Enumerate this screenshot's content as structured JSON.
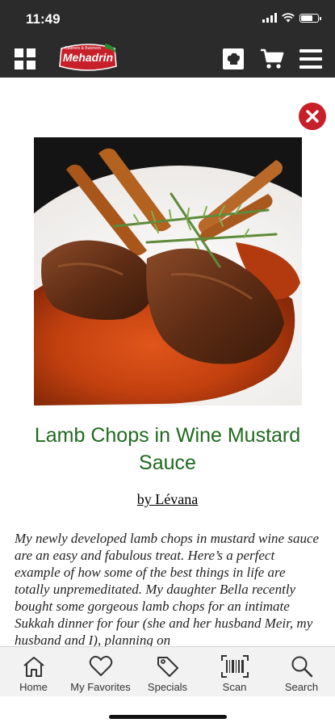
{
  "status_bar": {
    "time": "11:49",
    "icons": [
      "signal-icon",
      "wifi-icon",
      "battery-icon"
    ],
    "battery_level": 0.75
  },
  "header": {
    "menu_grid_icon": "grid-icon",
    "logo": {
      "text": "Mehadrin",
      "tagline": "Caterers & Butchers",
      "color": "#c8202a"
    },
    "icons": [
      "chef-hat-icon",
      "cart-icon",
      "hamburger-menu-icon"
    ],
    "background": "#2b2b2b"
  },
  "recipe": {
    "title": "Lamb Chops in Wine Mustard Sauce",
    "author": "by Lévana",
    "description": "My newly developed lamb chops in mustard wine sauce are an easy and fabulous treat. Here’s a perfect example of how some of the best things in life are totally unpremeditated. My daughter Bella recently bought some gorgeous lamb chops for an intimate Sukkah dinner for four (she and her husband Meir, my husband and I), planning on",
    "title_color": "#1f6a1f"
  },
  "close_button_icon": "close-icon",
  "tabs": [
    {
      "label": "Home",
      "icon": "home-icon"
    },
    {
      "label": "My Favorites",
      "icon": "heart-icon"
    },
    {
      "label": "Specials",
      "icon": "tag-icon"
    },
    {
      "label": "Scan",
      "icon": "barcode-icon"
    },
    {
      "label": "Search",
      "icon": "search-icon"
    }
  ]
}
